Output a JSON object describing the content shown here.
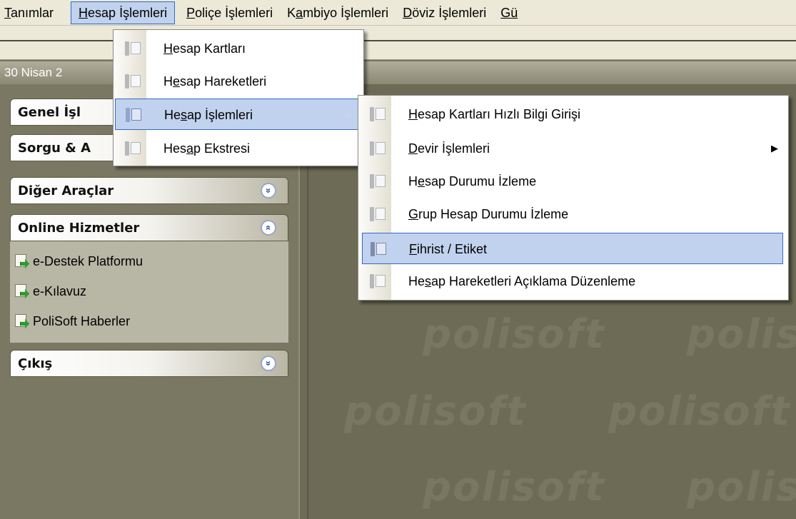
{
  "menubar": {
    "items": [
      {
        "pre": "",
        "key": "T",
        "post": "anımlar"
      },
      {
        "pre": "",
        "key": "H",
        "post": "esap İşlemleri"
      },
      {
        "pre": "",
        "key": "P",
        "post": "oliçe İşlemleri"
      },
      {
        "pre": "K",
        "key": "a",
        "post": "mbiyo İşlemleri"
      },
      {
        "pre": "",
        "key": "D",
        "post": "öviz İşlemleri"
      },
      {
        "pre": "",
        "key": "Gü",
        "post": ""
      }
    ]
  },
  "date_bar": {
    "text": "30 Nisan 2"
  },
  "sidebar": {
    "panels": [
      {
        "title": "Genel İşl"
      },
      {
        "title": "Sorgu & A"
      },
      {
        "title": "Diğer Araçlar",
        "chevron": "»"
      },
      {
        "title": "Online Hizmetler",
        "chevron": "«"
      },
      {
        "title": "Çıkış",
        "chevron": "»"
      }
    ],
    "online_links": [
      {
        "label": "e-Destek Platformu",
        "icon": "page-arrow-icon"
      },
      {
        "label": "e-Kılavuz",
        "icon": "page-arrow-icon"
      },
      {
        "label": "PoliSoft Haberler",
        "icon": "page-arrow-icon"
      }
    ]
  },
  "watermark": {
    "text": "polisoft"
  },
  "dropdown_menu": {
    "items": [
      {
        "pre": "",
        "key": "H",
        "post": "esap Kartları"
      },
      {
        "pre": "H",
        "key": "e",
        "post": "sap Hareketleri"
      },
      {
        "pre": "He",
        "key": "s",
        "post": "ap İşlemleri",
        "submenu": "▶"
      },
      {
        "pre": "Hes",
        "key": "a",
        "post": "p Ekstresi"
      }
    ]
  },
  "submenu": {
    "items": [
      {
        "pre": "",
        "key": "H",
        "post": "esap Kartları Hızlı Bilgi Girişi"
      },
      {
        "pre": "",
        "key": "D",
        "post": "evir İşlemleri",
        "submenu": "▶"
      },
      {
        "pre": "H",
        "key": "e",
        "post": "sap Durumu İzleme"
      },
      {
        "pre": "",
        "key": "G",
        "post": "rup Hesap Durumu İzleme"
      },
      {
        "pre": "",
        "key": "F",
        "post": "ihrist / Etiket"
      },
      {
        "pre": "He",
        "key": "s",
        "post": "ap Hareketleri Açıklama Düzenleme"
      }
    ]
  },
  "colors": {
    "highlight": "#c1d2ee",
    "highlight_border": "#316ac5",
    "workspace": "#6d6b55"
  }
}
